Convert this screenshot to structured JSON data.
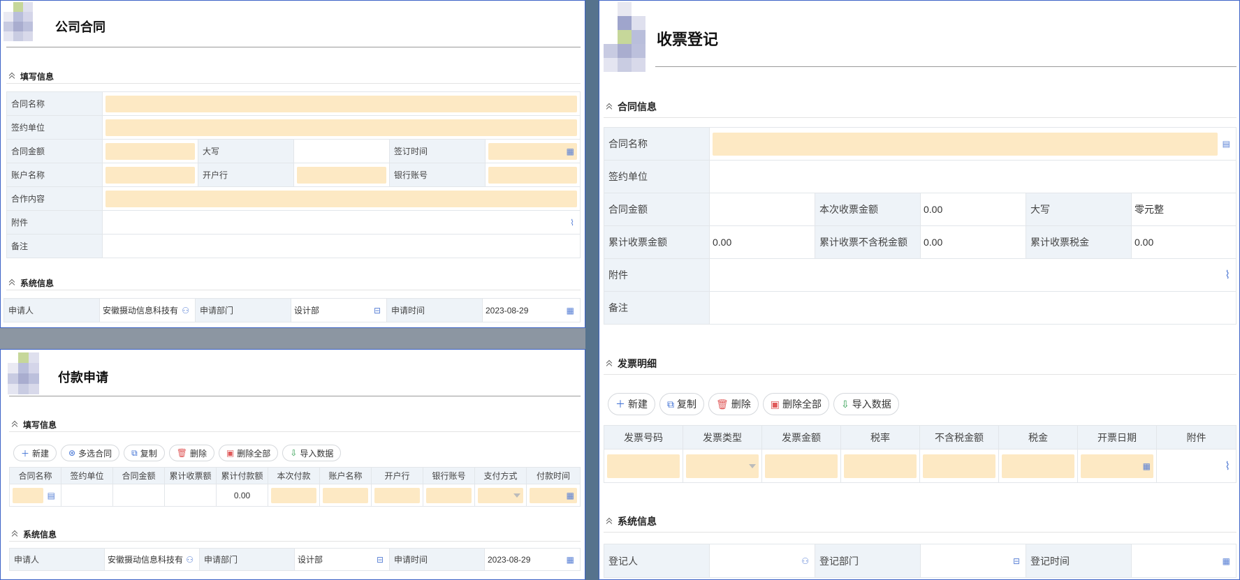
{
  "company_contract": {
    "title": "公司合同",
    "fill_section": "填写信息",
    "fields": {
      "contract_name": "合同名称",
      "sign_unit": "签约单位",
      "contract_amount": "合同金额",
      "uppercase": "大写",
      "sign_time": "签订时间",
      "account_name": "账户名称",
      "bank": "开户行",
      "bank_account": "银行账号",
      "cooperation": "合作内容",
      "attachment": "附件",
      "remark": "备注"
    },
    "system_section": "系统信息",
    "system": {
      "applicant_label": "申请人",
      "applicant_value": "安徽摄动信息科技有",
      "dept_label": "申请部门",
      "dept_value": "设计部",
      "time_label": "申请时间",
      "time_value": "2023-08-29"
    }
  },
  "payment_request": {
    "title": "付款申请",
    "fill_section": "填写信息",
    "toolbar": [
      "新建",
      "多选合同",
      "复制",
      "删除",
      "删除全部",
      "导入数据"
    ],
    "columns": [
      "合同名称",
      "签约单位",
      "合同金额",
      "累计收票额",
      "累计付款额",
      "本次付款",
      "账户名称",
      "开户行",
      "银行账号",
      "支付方式",
      "付款时间"
    ],
    "row": {
      "cumulative_paid": "0.00"
    },
    "system_section": "系统信息",
    "system": {
      "applicant_label": "申请人",
      "applicant_value": "安徽摄动信息科技有",
      "dept_label": "申请部门",
      "dept_value": "设计部",
      "time_label": "申请时间",
      "time_value": "2023-08-29"
    }
  },
  "invoice_register": {
    "title": "收票登记",
    "contract_section": "合同信息",
    "fields": {
      "contract_name": "合同名称",
      "sign_unit": "签约单位",
      "contract_amount": "合同金额",
      "this_invoice_amount": "本次收票金额",
      "this_invoice_value": "0.00",
      "uppercase": "大写",
      "uppercase_value": "零元整",
      "cum_invoice": "累计收票金额",
      "cum_invoice_value": "0.00",
      "cum_untaxed": "累计收票不含税金额",
      "cum_untaxed_value": "0.00",
      "cum_tax": "累计收票税金",
      "cum_tax_value": "0.00",
      "attachment": "附件",
      "remark": "备注"
    },
    "detail_section": "发票明细",
    "toolbar": [
      "新建",
      "复制",
      "删除",
      "删除全部",
      "导入数据"
    ],
    "columns": [
      "发票号码",
      "发票类型",
      "发票金额",
      "税率",
      "不含税金额",
      "税金",
      "开票日期",
      "附件"
    ],
    "system_section": "系统信息",
    "system": {
      "registrant_label": "登记人",
      "dept_label": "登记部门",
      "time_label": "登记时间"
    }
  }
}
